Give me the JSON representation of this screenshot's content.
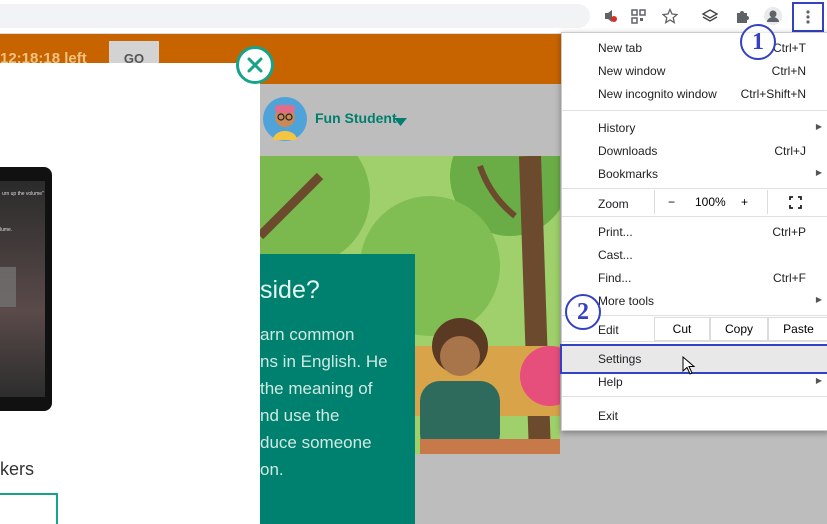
{
  "header": {
    "timer_text": "12:18:18 left",
    "go_label": "GO",
    "student_name": "Fun Student"
  },
  "card": {
    "heading": "side?",
    "lines": [
      "arn common",
      "ns in English. He",
      "the meaning of",
      "nd use the",
      "duce someone",
      "on."
    ]
  },
  "left_panel": {
    "speakers_text": "kers",
    "phone_line1": "urn up the volume\"",
    "phone_line2": "lume."
  },
  "menu": {
    "new_tab": "New tab",
    "new_tab_sc": "Ctrl+T",
    "new_window": "New window",
    "new_window_sc": "Ctrl+N",
    "incognito": "New incognito window",
    "incognito_sc": "Ctrl+Shift+N",
    "history": "History",
    "downloads": "Downloads",
    "downloads_sc": "Ctrl+J",
    "bookmarks": "Bookmarks",
    "zoom": "Zoom",
    "zoom_minus": "−",
    "zoom_value": "100%",
    "zoom_plus": "+",
    "print": "Print...",
    "print_sc": "Ctrl+P",
    "cast": "Cast...",
    "find": "Find...",
    "find_sc": "Ctrl+F",
    "more_tools": "More tools",
    "edit": "Edit",
    "cut": "Cut",
    "copy": "Copy",
    "paste": "Paste",
    "settings": "Settings",
    "help": "Help",
    "exit": "Exit"
  },
  "annotations": {
    "step1": "1",
    "step2": "2"
  },
  "colors": {
    "accent": "#3341c2",
    "orange": "#c86400",
    "teal": "#00806e"
  }
}
